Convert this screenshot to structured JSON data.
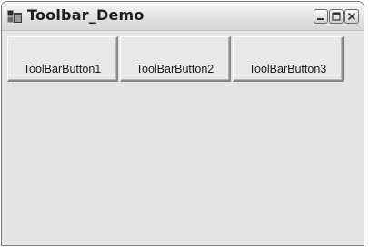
{
  "window": {
    "title": "Toolbar_Demo",
    "icon": "app-window-icon"
  },
  "caption_buttons": {
    "minimize_icon": "minimize-icon",
    "maximize_icon": "maximize-icon",
    "close_icon": "close-icon"
  },
  "toolbar": {
    "buttons": [
      {
        "label": "ToolBarButton1"
      },
      {
        "label": "ToolBarButton2"
      },
      {
        "label": "ToolBarButton3"
      }
    ]
  },
  "colors": {
    "window_background": "#e4e4e4",
    "title_text": "#1e1e1e"
  }
}
